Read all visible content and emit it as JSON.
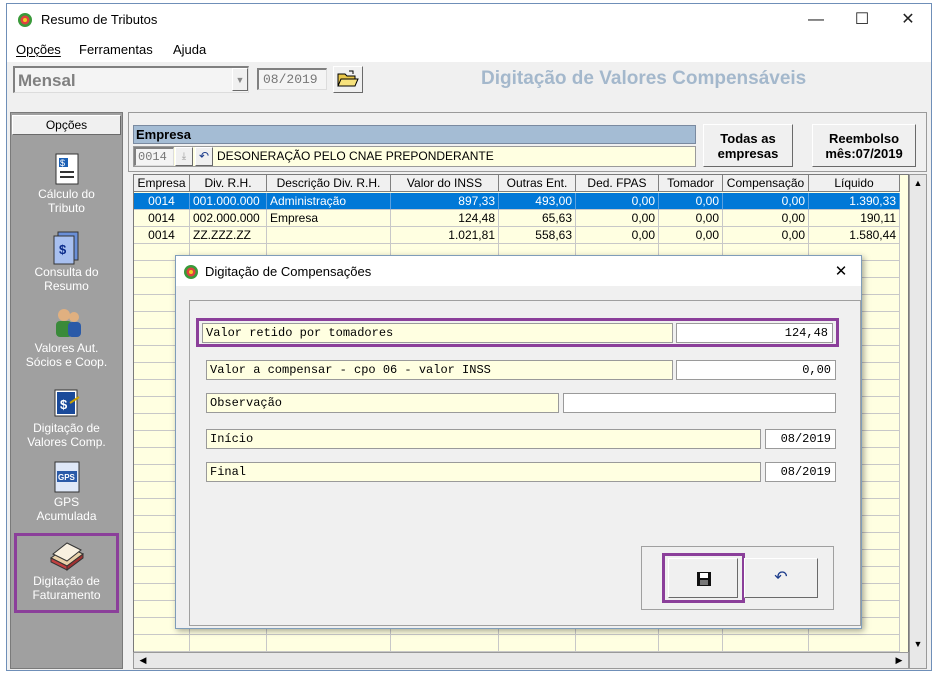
{
  "window": {
    "title": "Resumo de Tributos",
    "minimize": "—",
    "maximize": "☐",
    "close": "✕"
  },
  "menu": {
    "opcoes": "Opções",
    "ferramentas": "Ferramentas",
    "ajuda": "Ajuda"
  },
  "toolbar": {
    "period_type": "Mensal",
    "period": "08/2019",
    "heading": "Digitação de Valores Compensáveis"
  },
  "left_panel": {
    "header": "Opções",
    "items": [
      {
        "label": "Cálculo do Tributo"
      },
      {
        "label": "Consulta do Resumo"
      },
      {
        "label": "Valores Aut. Sócios e  Coop."
      },
      {
        "label": "Digitação de Valores Comp."
      },
      {
        "label": "GPS Acumulada"
      },
      {
        "label": "Digitação de Faturamento"
      }
    ]
  },
  "empresa": {
    "label": "Empresa",
    "code": "0014",
    "name": "DESONERAÇÃO PELO CNAE PREPONDERANTE",
    "todas_button": "Todas as empresas",
    "reembolso_button": "Reembolso mês:07/2019"
  },
  "grid": {
    "columns": [
      "Empresa",
      "Div. R.H.",
      "Descrição Div. R.H.",
      "Valor do INSS",
      "Outras Ent.",
      "Ded. FPAS",
      "Tomador",
      "Compensação",
      "Líquido"
    ],
    "rows": [
      [
        "0014",
        "001.000.000",
        "Administração",
        "897,33",
        "493,00",
        "0,00",
        "0,00",
        "0,00",
        "1.390,33"
      ],
      [
        "0014",
        "002.000.000",
        "Empresa",
        "124,48",
        "65,63",
        "0,00",
        "0,00",
        "0,00",
        "190,11"
      ],
      [
        "0014",
        "ZZ.ZZZ.ZZ",
        "",
        "1.021,81",
        "558,63",
        "0,00",
        "0,00",
        "0,00",
        "1.580,44"
      ]
    ]
  },
  "dialog": {
    "title": "Digitação de Compensações",
    "close": "✕",
    "valor_retido_label": "Valor retido por tomadores",
    "valor_retido_value": "124,48",
    "valor_compensar_label": "Valor a compensar - cpo 06 - valor INSS",
    "valor_compensar_value": "0,00",
    "observacao_label": "Observação",
    "observacao_value": "",
    "inicio_label": "Início",
    "inicio_value": "08/2019",
    "final_label": "Final",
    "final_value": "08/2019"
  },
  "colors": {
    "selection": "#0078d7",
    "highlight": "#8b3f9a",
    "heading": "#a4b8cc",
    "field_yellow": "#ffffe1",
    "panel_gray": "#a0a0a0"
  }
}
